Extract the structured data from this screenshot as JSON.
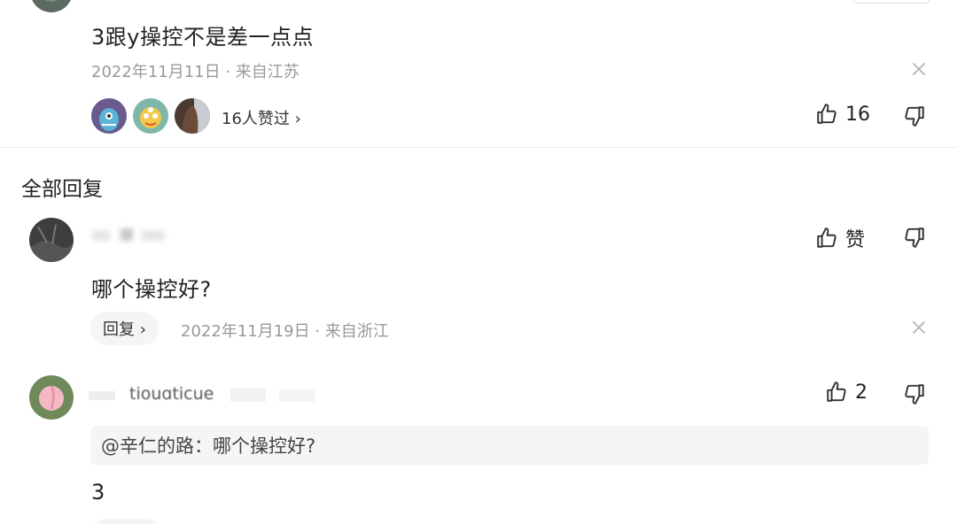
{
  "top_comment": {
    "text": "3跟y操控不是差一点点",
    "date_location": "2022年11月11日 · 来自江苏",
    "likers_label": "16人赞过 ›",
    "like_count": "16"
  },
  "section_title": "全部回复",
  "replies": [
    {
      "text": "哪个操控好?",
      "like_label": "赞",
      "reply_button": "回复 ›",
      "date_location": "2022年11月19日 · 来自浙江"
    },
    {
      "username_partial": "tiouɑticue",
      "like_count": "2",
      "quote": "@辛仁的路：哪个操控好?",
      "text": "3"
    }
  ],
  "icons": {
    "like": "thumbs-up-icon",
    "dislike": "thumbs-down-icon",
    "close": "close-icon"
  }
}
